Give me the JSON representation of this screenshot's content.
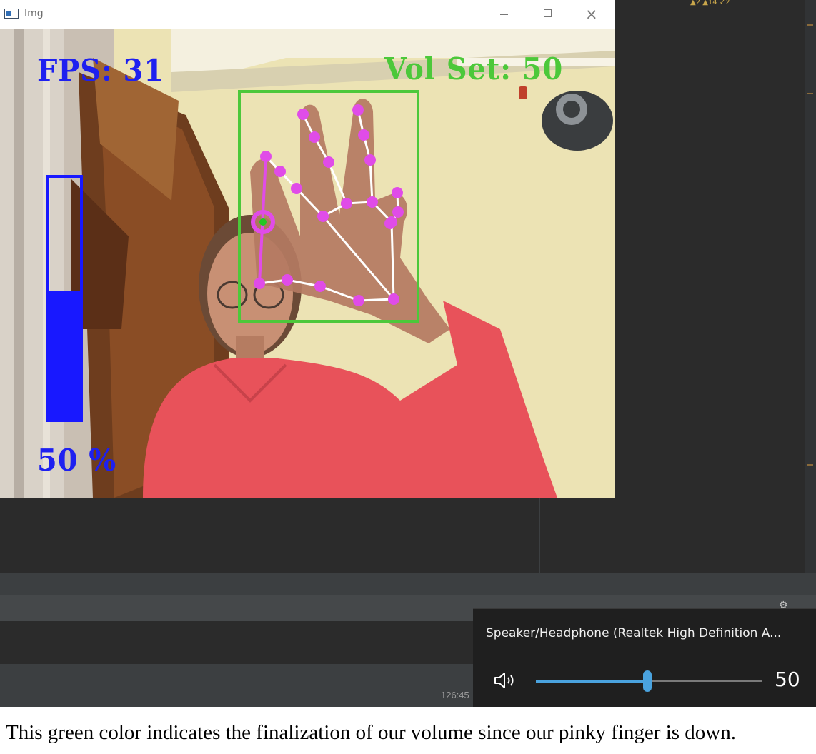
{
  "window": {
    "title": "Img",
    "minimize": "—",
    "maximize": "☐",
    "close": "✕"
  },
  "overlay": {
    "fps_label": "FPS: 31",
    "vol_set_label": "Vol Set: 50",
    "percent_label": "50 %",
    "volume_level": 0.5,
    "colors": {
      "fps": "#1e20f0",
      "vol_set": "#4cc83a",
      "bar": "#1818ff",
      "bbox": "#4cc83a",
      "landmarks": "#e04ce8",
      "connections": "#ffffff",
      "active_point": "#22c922"
    }
  },
  "taskbar": {
    "clock": "126:45"
  },
  "volume_flyout": {
    "device": "Speaker/Headphone (Realtek High Definition A...",
    "value": "50",
    "level": 0.5,
    "icon": "speaker-icon",
    "accent": "#4aa3df"
  },
  "caption": "This green color indicates the finalization of our volume since our pinky finger is down."
}
